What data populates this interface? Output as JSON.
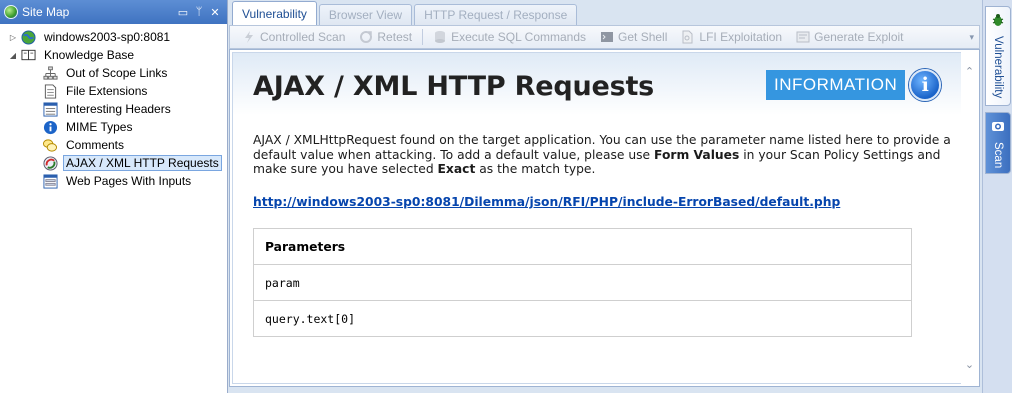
{
  "sitemap": {
    "title": "Site Map",
    "buttons": {
      "minimize": "▭",
      "pin": "ᛘ",
      "close": "✕"
    },
    "tree": [
      {
        "label": "windows2003-sp0:8081",
        "icon": "globe-icon",
        "expander": "▷"
      },
      {
        "label": "Knowledge Base",
        "icon": "book-icon",
        "expander": "◢"
      }
    ],
    "knowledge_base_items": [
      {
        "label": "Out of Scope Links",
        "icon": "sitemap-icon"
      },
      {
        "label": "File Extensions",
        "icon": "document-icon"
      },
      {
        "label": "Interesting Headers",
        "icon": "list-icon"
      },
      {
        "label": "MIME Types",
        "icon": "info-icon"
      },
      {
        "label": "Comments",
        "icon": "comment-icon"
      },
      {
        "label": "AJAX / XML HTTP Requests",
        "icon": "ajax-icon",
        "selected": true
      },
      {
        "label": "Web Pages With Inputs",
        "icon": "form-icon"
      }
    ]
  },
  "tabs": [
    "Vulnerability",
    "Browser View",
    "HTTP Request / Response"
  ],
  "toolbar": {
    "controlled_scan": "Controlled Scan",
    "retest": "Retest",
    "execute_sql": "Execute SQL Commands",
    "get_shell": "Get Shell",
    "lfi_exploitation": "LFI Exploitation",
    "generate_exploit": "Generate Exploit"
  },
  "vulnerability": {
    "title": "AJAX / XML HTTP Requests",
    "severity": "INFORMATION",
    "severity_icon": "i",
    "description": {
      "part1": "AJAX / XMLHttpRequest found on the target application. You can use the parameter name listed here to provide a default value when attacking. To add a default value, please use ",
      "form_values": "Form Values",
      "part2": " in your Scan Policy Settings and make sure you have selected ",
      "exact": "Exact",
      "part3": " as the match type."
    },
    "url": "http://windows2003-sp0:8081/Dilemma/json/RFI/PHP/include-ErrorBased/default.php",
    "params_header": "Parameters",
    "params": [
      "param",
      "query.text[0]"
    ]
  },
  "scrollbar": {
    "up": "⌃",
    "down": "⌄"
  },
  "right_dock": {
    "vulnerability": "Vulnerability",
    "scan": "Scan"
  },
  "colors": {
    "accent": "#3596e0",
    "link": "#0645ad",
    "titlebar": "#4a7fcb"
  }
}
